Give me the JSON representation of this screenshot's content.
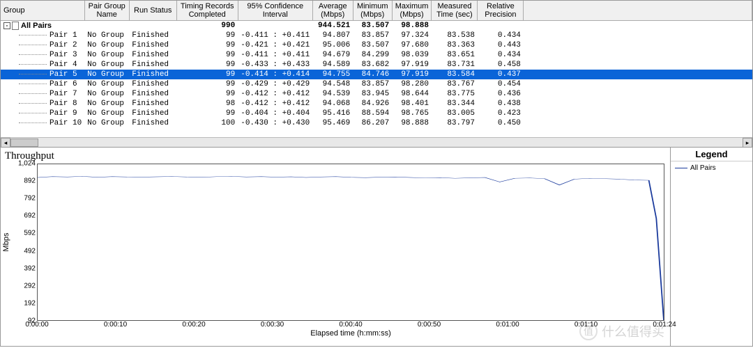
{
  "columns": [
    "Group",
    "Pair Group\nName",
    "Run Status",
    "Timing Records\nCompleted",
    "95% Confidence\nInterval",
    "Average\n(Mbps)",
    "Minimum\n(Mbps)",
    "Maximum\n(Mbps)",
    "Measured\nTime (sec)",
    "Relative\nPrecision"
  ],
  "summary": {
    "label": "All Pairs",
    "completed": "990",
    "avg": "944.521",
    "min": "83.507",
    "max": "98.888"
  },
  "rows": [
    {
      "pair": "Pair 1",
      "pg": "No Group",
      "status": "Finished",
      "completed": "99",
      "ci": "-0.411 : +0.411",
      "avg": "94.807",
      "min": "83.857",
      "max": "97.324",
      "time": "83.538",
      "prec": "0.434",
      "sel": false
    },
    {
      "pair": "Pair 2",
      "pg": "No Group",
      "status": "Finished",
      "completed": "99",
      "ci": "-0.421 : +0.421",
      "avg": "95.006",
      "min": "83.507",
      "max": "97.680",
      "time": "83.363",
      "prec": "0.443",
      "sel": false
    },
    {
      "pair": "Pair 3",
      "pg": "No Group",
      "status": "Finished",
      "completed": "99",
      "ci": "-0.411 : +0.411",
      "avg": "94.679",
      "min": "84.299",
      "max": "98.039",
      "time": "83.651",
      "prec": "0.434",
      "sel": false
    },
    {
      "pair": "Pair 4",
      "pg": "No Group",
      "status": "Finished",
      "completed": "99",
      "ci": "-0.433 : +0.433",
      "avg": "94.589",
      "min": "83.682",
      "max": "97.919",
      "time": "83.731",
      "prec": "0.458",
      "sel": false
    },
    {
      "pair": "Pair 5",
      "pg": "No Group",
      "status": "Finished",
      "completed": "99",
      "ci": "-0.414 : +0.414",
      "avg": "94.755",
      "min": "84.746",
      "max": "97.919",
      "time": "83.584",
      "prec": "0.437",
      "sel": true
    },
    {
      "pair": "Pair 6",
      "pg": "No Group",
      "status": "Finished",
      "completed": "99",
      "ci": "-0.429 : +0.429",
      "avg": "94.548",
      "min": "83.857",
      "max": "98.280",
      "time": "83.767",
      "prec": "0.454",
      "sel": false
    },
    {
      "pair": "Pair 7",
      "pg": "No Group",
      "status": "Finished",
      "completed": "99",
      "ci": "-0.412 : +0.412",
      "avg": "94.539",
      "min": "83.945",
      "max": "98.644",
      "time": "83.775",
      "prec": "0.436",
      "sel": false
    },
    {
      "pair": "Pair 8",
      "pg": "No Group",
      "status": "Finished",
      "completed": "98",
      "ci": "-0.412 : +0.412",
      "avg": "94.068",
      "min": "84.926",
      "max": "98.401",
      "time": "83.344",
      "prec": "0.438",
      "sel": false
    },
    {
      "pair": "Pair 9",
      "pg": "No Group",
      "status": "Finished",
      "completed": "99",
      "ci": "-0.404 : +0.404",
      "avg": "95.416",
      "min": "88.594",
      "max": "98.765",
      "time": "83.005",
      "prec": "0.423",
      "sel": false
    },
    {
      "pair": "Pair 10",
      "pg": "No Group",
      "status": "Finished",
      "completed": "100",
      "ci": "-0.430 : +0.430",
      "avg": "95.469",
      "min": "86.207",
      "max": "98.888",
      "time": "83.797",
      "prec": "0.450",
      "sel": false
    }
  ],
  "chart": {
    "title": "Throughput",
    "ylabel": "Mbps",
    "xlabel": "Elapsed time (h:mm:ss)",
    "yticks": [
      "1,024",
      "892",
      "792",
      "692",
      "592",
      "492",
      "392",
      "292",
      "192",
      "92"
    ],
    "xticks": [
      "0:00:00",
      "0:00:10",
      "0:00:20",
      "0:00:30",
      "0:00:40",
      "0:00:50",
      "0:01:00",
      "0:01:10",
      "0:01:24"
    ]
  },
  "chart_data": {
    "type": "line",
    "title": "Throughput",
    "xlabel": "Elapsed time (h:mm:ss)",
    "ylabel": "Mbps",
    "ylim": [
      92,
      1024
    ],
    "x_seconds": [
      0,
      2,
      4,
      6,
      8,
      10,
      12,
      14,
      16,
      18,
      20,
      22,
      24,
      26,
      28,
      30,
      32,
      34,
      36,
      38,
      40,
      42,
      44,
      46,
      48,
      50,
      52,
      54,
      56,
      58,
      60,
      62,
      64,
      66,
      68,
      70,
      72,
      74,
      76,
      78,
      80,
      82,
      83,
      84
    ],
    "series": [
      {
        "name": "All Pairs",
        "color": "#1a3a9c",
        "values": [
          945,
          950,
          948,
          952,
          946,
          950,
          948,
          947,
          949,
          951,
          948,
          946,
          950,
          952,
          948,
          950,
          947,
          949,
          945,
          948,
          950,
          946,
          944,
          947,
          948,
          945,
          942,
          944,
          940,
          943,
          945,
          918,
          940,
          942,
          938,
          900,
          935,
          940,
          938,
          935,
          930,
          928,
          700,
          92
        ]
      }
    ]
  },
  "legend": {
    "title": "Legend",
    "items": [
      {
        "label": "All Pairs",
        "color": "#1a3a9c"
      }
    ]
  },
  "watermark": {
    "badge": "值",
    "text": "什么值得买"
  }
}
